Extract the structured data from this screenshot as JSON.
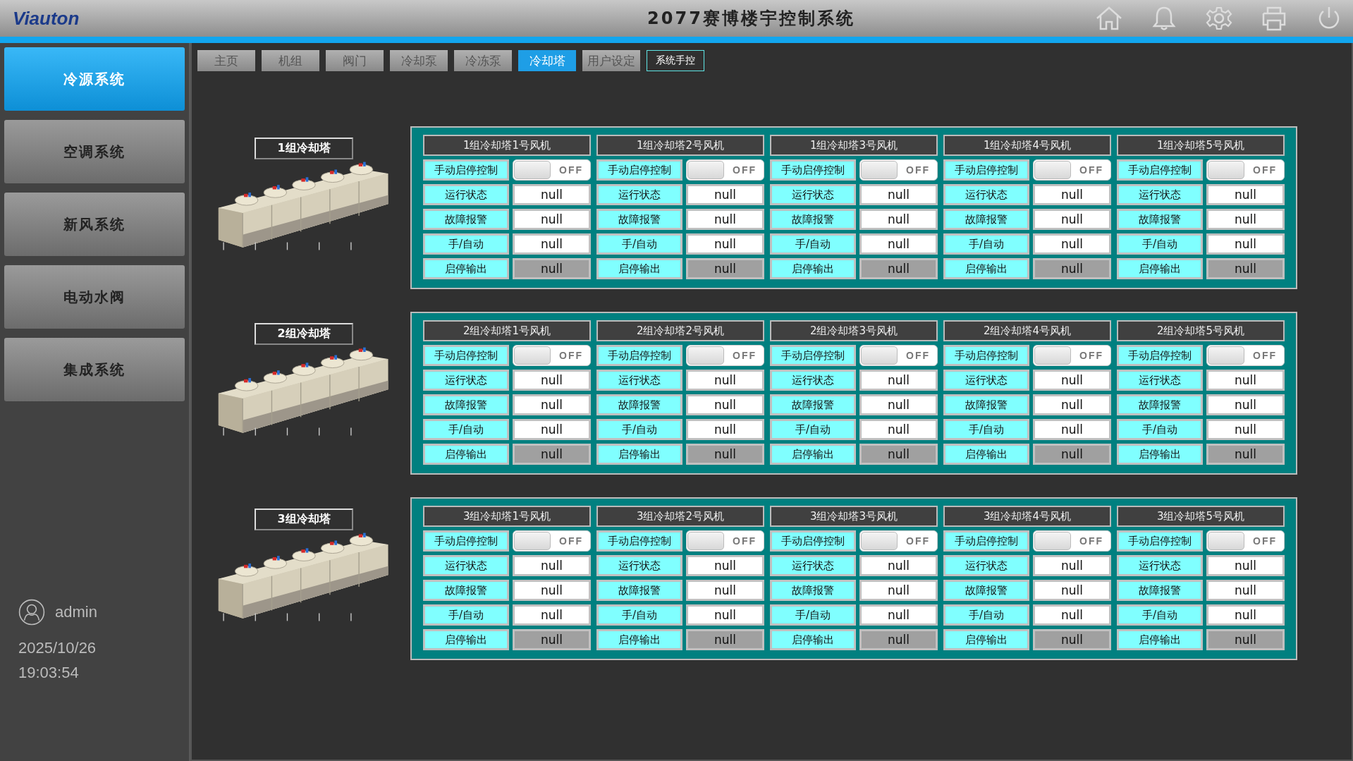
{
  "header": {
    "logo": "Viauton",
    "title": "2077赛博楼宇控制系统"
  },
  "sidebar": {
    "items": [
      {
        "label": "冷源系统",
        "selected": true
      },
      {
        "label": "空调系统",
        "selected": false
      },
      {
        "label": "新风系统",
        "selected": false
      },
      {
        "label": "电动水阀",
        "selected": false
      },
      {
        "label": "集成系统",
        "selected": false
      }
    ],
    "user": "admin",
    "date": "2025/10/26",
    "time": "19:03:54"
  },
  "tabs": [
    {
      "label": "主页",
      "kind": "tab",
      "selected": false
    },
    {
      "label": "机组",
      "kind": "tab",
      "selected": false
    },
    {
      "label": "阀门",
      "kind": "tab",
      "selected": false
    },
    {
      "label": "冷却泵",
      "kind": "tab",
      "selected": false
    },
    {
      "label": "冷冻泵",
      "kind": "tab",
      "selected": false
    },
    {
      "label": "冷却塔",
      "kind": "tab",
      "selected": true
    },
    {
      "label": "用户设定",
      "kind": "tab",
      "selected": false
    },
    {
      "label": "系统手控",
      "kind": "button",
      "selected": false
    }
  ],
  "groups": [
    {
      "title": "1组冷却塔",
      "fans": [
        {
          "title": "1组冷却塔1号风机",
          "rows": [
            {
              "label": "手动启停控制",
              "kind": "switch",
              "on": false,
              "value": "OFF"
            },
            {
              "label": "运行状态",
              "kind": "status",
              "value": "null"
            },
            {
              "label": "故障报警",
              "kind": "status",
              "value": "null"
            },
            {
              "label": "手/自动",
              "kind": "status",
              "value": "null"
            },
            {
              "label": "启停输出",
              "kind": "output",
              "value": "null"
            }
          ]
        },
        {
          "title": "1组冷却塔2号风机",
          "rows": [
            {
              "label": "手动启停控制",
              "kind": "switch",
              "on": false,
              "value": "OFF"
            },
            {
              "label": "运行状态",
              "kind": "status",
              "value": "null"
            },
            {
              "label": "故障报警",
              "kind": "status",
              "value": "null"
            },
            {
              "label": "手/自动",
              "kind": "status",
              "value": "null"
            },
            {
              "label": "启停输出",
              "kind": "output",
              "value": "null"
            }
          ]
        },
        {
          "title": "1组冷却塔3号风机",
          "rows": [
            {
              "label": "手动启停控制",
              "kind": "switch",
              "on": false,
              "value": "OFF"
            },
            {
              "label": "运行状态",
              "kind": "status",
              "value": "null"
            },
            {
              "label": "故障报警",
              "kind": "status",
              "value": "null"
            },
            {
              "label": "手/自动",
              "kind": "status",
              "value": "null"
            },
            {
              "label": "启停输出",
              "kind": "output",
              "value": "null"
            }
          ]
        },
        {
          "title": "1组冷却塔4号风机",
          "rows": [
            {
              "label": "手动启停控制",
              "kind": "switch",
              "on": false,
              "value": "OFF"
            },
            {
              "label": "运行状态",
              "kind": "status",
              "value": "null"
            },
            {
              "label": "故障报警",
              "kind": "status",
              "value": "null"
            },
            {
              "label": "手/自动",
              "kind": "status",
              "value": "null"
            },
            {
              "label": "启停输出",
              "kind": "output",
              "value": "null"
            }
          ]
        },
        {
          "title": "1组冷却塔5号风机",
          "rows": [
            {
              "label": "手动启停控制",
              "kind": "switch",
              "on": false,
              "value": "OFF"
            },
            {
              "label": "运行状态",
              "kind": "status",
              "value": "null"
            },
            {
              "label": "故障报警",
              "kind": "status",
              "value": "null"
            },
            {
              "label": "手/自动",
              "kind": "status",
              "value": "null"
            },
            {
              "label": "启停输出",
              "kind": "output",
              "value": "null"
            }
          ]
        }
      ]
    },
    {
      "title": "2组冷却塔",
      "fans": [
        {
          "title": "2组冷却塔1号风机",
          "rows": [
            {
              "label": "手动启停控制",
              "kind": "switch",
              "on": false,
              "value": "OFF"
            },
            {
              "label": "运行状态",
              "kind": "status",
              "value": "null"
            },
            {
              "label": "故障报警",
              "kind": "status",
              "value": "null"
            },
            {
              "label": "手/自动",
              "kind": "status",
              "value": "null"
            },
            {
              "label": "启停输出",
              "kind": "output",
              "value": "null"
            }
          ]
        },
        {
          "title": "2组冷却塔2号风机",
          "rows": [
            {
              "label": "手动启停控制",
              "kind": "switch",
              "on": false,
              "value": "OFF"
            },
            {
              "label": "运行状态",
              "kind": "status",
              "value": "null"
            },
            {
              "label": "故障报警",
              "kind": "status",
              "value": "null"
            },
            {
              "label": "手/自动",
              "kind": "status",
              "value": "null"
            },
            {
              "label": "启停输出",
              "kind": "output",
              "value": "null"
            }
          ]
        },
        {
          "title": "2组冷却塔3号风机",
          "rows": [
            {
              "label": "手动启停控制",
              "kind": "switch",
              "on": false,
              "value": "OFF"
            },
            {
              "label": "运行状态",
              "kind": "status",
              "value": "null"
            },
            {
              "label": "故障报警",
              "kind": "status",
              "value": "null"
            },
            {
              "label": "手/自动",
              "kind": "status",
              "value": "null"
            },
            {
              "label": "启停输出",
              "kind": "output",
              "value": "null"
            }
          ]
        },
        {
          "title": "2组冷却塔4号风机",
          "rows": [
            {
              "label": "手动启停控制",
              "kind": "switch",
              "on": false,
              "value": "OFF"
            },
            {
              "label": "运行状态",
              "kind": "status",
              "value": "null"
            },
            {
              "label": "故障报警",
              "kind": "status",
              "value": "null"
            },
            {
              "label": "手/自动",
              "kind": "status",
              "value": "null"
            },
            {
              "label": "启停输出",
              "kind": "output",
              "value": "null"
            }
          ]
        },
        {
          "title": "2组冷却塔5号风机",
          "rows": [
            {
              "label": "手动启停控制",
              "kind": "switch",
              "on": false,
              "value": "OFF"
            },
            {
              "label": "运行状态",
              "kind": "status",
              "value": "null"
            },
            {
              "label": "故障报警",
              "kind": "status",
              "value": "null"
            },
            {
              "label": "手/自动",
              "kind": "status",
              "value": "null"
            },
            {
              "label": "启停输出",
              "kind": "output",
              "value": "null"
            }
          ]
        }
      ]
    },
    {
      "title": "3组冷却塔",
      "fans": [
        {
          "title": "3组冷却塔1号风机",
          "rows": [
            {
              "label": "手动启停控制",
              "kind": "switch",
              "on": false,
              "value": "OFF"
            },
            {
              "label": "运行状态",
              "kind": "status",
              "value": "null"
            },
            {
              "label": "故障报警",
              "kind": "status",
              "value": "null"
            },
            {
              "label": "手/自动",
              "kind": "status",
              "value": "null"
            },
            {
              "label": "启停输出",
              "kind": "output",
              "value": "null"
            }
          ]
        },
        {
          "title": "3组冷却塔2号风机",
          "rows": [
            {
              "label": "手动启停控制",
              "kind": "switch",
              "on": false,
              "value": "OFF"
            },
            {
              "label": "运行状态",
              "kind": "status",
              "value": "null"
            },
            {
              "label": "故障报警",
              "kind": "status",
              "value": "null"
            },
            {
              "label": "手/自动",
              "kind": "status",
              "value": "null"
            },
            {
              "label": "启停输出",
              "kind": "output",
              "value": "null"
            }
          ]
        },
        {
          "title": "3组冷却塔3号风机",
          "rows": [
            {
              "label": "手动启停控制",
              "kind": "switch",
              "on": false,
              "value": "OFF"
            },
            {
              "label": "运行状态",
              "kind": "status",
              "value": "null"
            },
            {
              "label": "故障报警",
              "kind": "status",
              "value": "null"
            },
            {
              "label": "手/自动",
              "kind": "status",
              "value": "null"
            },
            {
              "label": "启停输出",
              "kind": "output",
              "value": "null"
            }
          ]
        },
        {
          "title": "3组冷却塔4号风机",
          "rows": [
            {
              "label": "手动启停控制",
              "kind": "switch",
              "on": false,
              "value": "OFF"
            },
            {
              "label": "运行状态",
              "kind": "status",
              "value": "null"
            },
            {
              "label": "故障报警",
              "kind": "status",
              "value": "null"
            },
            {
              "label": "手/自动",
              "kind": "status",
              "value": "null"
            },
            {
              "label": "启停输出",
              "kind": "output",
              "value": "null"
            }
          ]
        },
        {
          "title": "3组冷却塔5号风机",
          "rows": [
            {
              "label": "手动启停控制",
              "kind": "switch",
              "on": false,
              "value": "OFF"
            },
            {
              "label": "运行状态",
              "kind": "status",
              "value": "null"
            },
            {
              "label": "故障报警",
              "kind": "status",
              "value": "null"
            },
            {
              "label": "手/自动",
              "kind": "status",
              "value": "null"
            },
            {
              "label": "启停输出",
              "kind": "output",
              "value": "null"
            }
          ]
        }
      ]
    }
  ]
}
